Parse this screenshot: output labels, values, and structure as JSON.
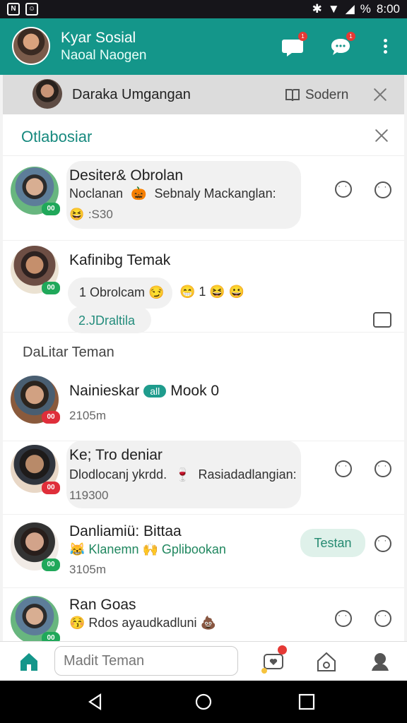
{
  "statusbar": {
    "time": "8:00",
    "left_icons": [
      "N",
      "cat"
    ],
    "right_icons": [
      "bluetooth-icon",
      "wifi-icon",
      "signal-icon",
      "battery-icon"
    ],
    "battery_text": "%"
  },
  "header": {
    "title": "Kyar Sosial",
    "subtitle": "Naoal Naogen",
    "badge_count_1": "1",
    "badge_count_2": "1"
  },
  "notification": {
    "title": "Daraka Umgangan",
    "action_label": "Sodern"
  },
  "panel": {
    "title": "Otlabosiar"
  },
  "chats": [
    {
      "name": "Desiter& Obrolan",
      "message": "Noclanan  🎃  Sebnaly Mackanglan:",
      "time": "😆 :S30",
      "badge": "00"
    },
    {
      "name": "Kafinibg Temak",
      "bubble1": "1 Obrolcam 😏",
      "inline": "😁 1 😆 😀",
      "bubble2": "2.JDraltila",
      "badge": "00"
    }
  ],
  "section": {
    "label": "DaLitar Teman"
  },
  "friends": [
    {
      "name": "Nainieskar",
      "pill": "all",
      "extra": "Mook 0",
      "time": "2105m",
      "badge": "00"
    },
    {
      "name": "Ke; Tro deniar",
      "message": "Dlodlocanj ykrdd.  🍷  Rasiadadlangian:",
      "time": "119300",
      "badge": "00"
    },
    {
      "name": "Danliamiü: Bittaa",
      "message": "😹 Klanemn 🙌 Gplibookan",
      "time": "3105m",
      "chip": "Testan",
      "badge": "00"
    },
    {
      "name": "Ran Goas",
      "message": "😚 Rdos ayaudkadluni 💩",
      "badge": "00"
    }
  ],
  "bottom_nav": {
    "search_placeholder": "Madit Teman"
  },
  "colors": {
    "primary": "#14968a",
    "accent_green": "#20a85a",
    "accent_red": "#df2e3a"
  }
}
